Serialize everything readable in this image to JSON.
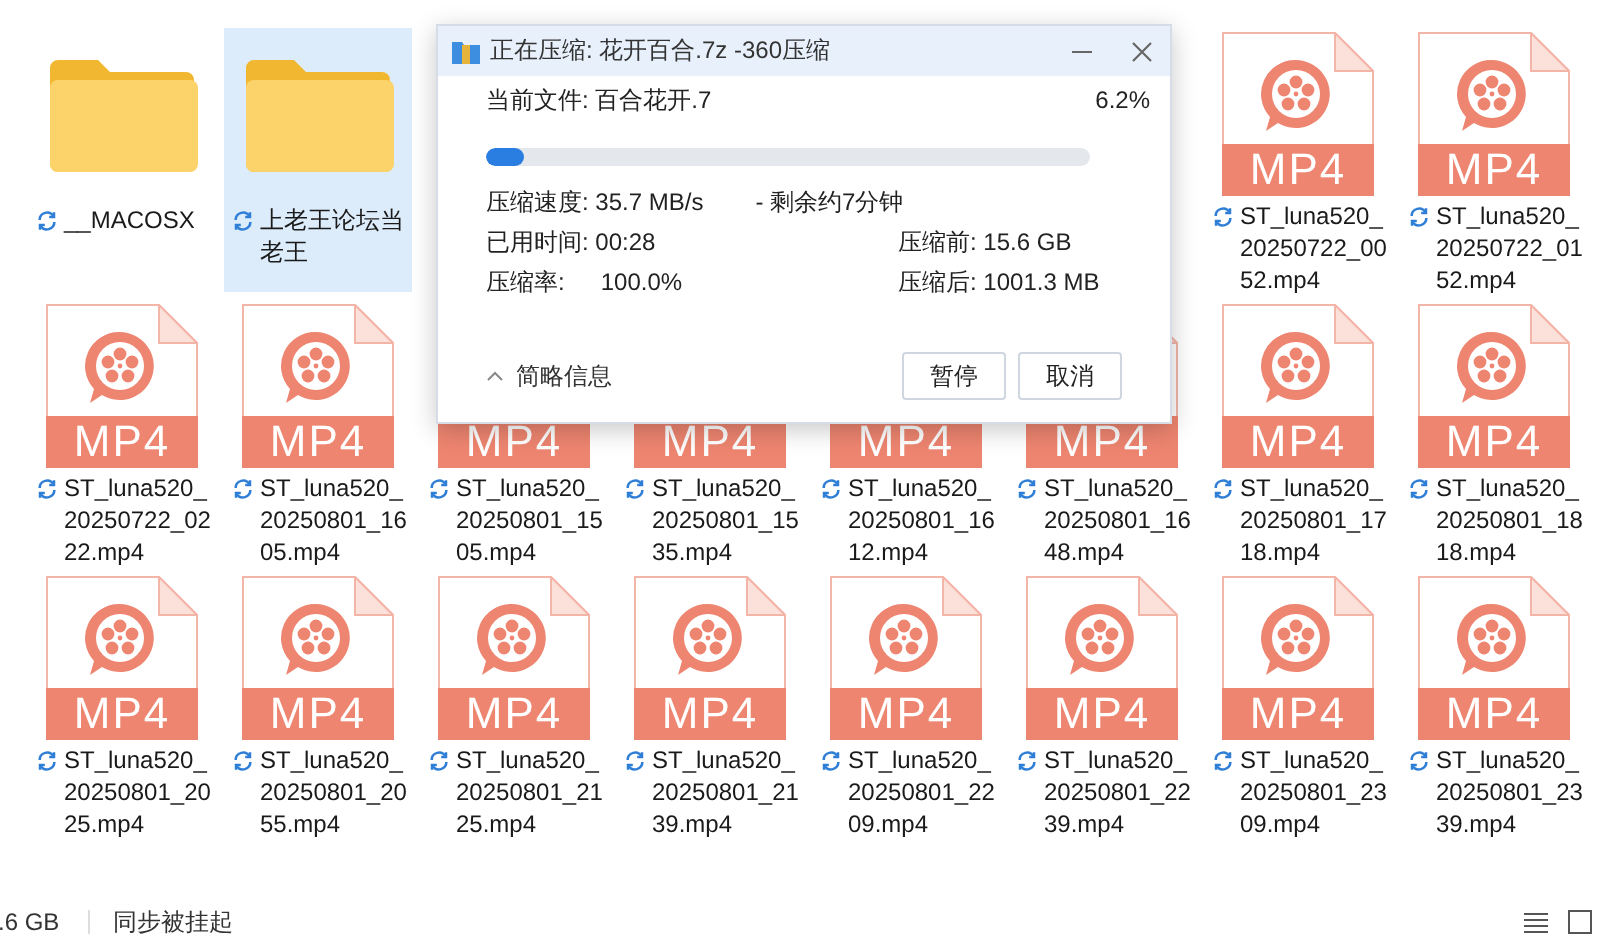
{
  "rows": [
    {
      "items": [
        {
          "kind": "folder",
          "name": "__MACOSX",
          "selected": false
        },
        {
          "kind": "folder",
          "name": "上老王论坛当老王",
          "selected": true
        },
        {
          "kind": "mp4",
          "name": "ST_luna520_20250722_0052.mp4",
          "badge": "MP4",
          "selected": false
        },
        {
          "kind": "mp4",
          "name": "ST_luna520_20250722_0152.mp4",
          "badge": "MP4",
          "selected": false
        }
      ]
    },
    {
      "items": [
        {
          "kind": "mp4",
          "name": "ST_luna520_20250722_0222.mp4",
          "badge": "MP4",
          "selected": false
        },
        {
          "kind": "mp4",
          "name": "ST_luna520_20250801_1605.mp4",
          "badge": "MP4",
          "selected": false
        },
        {
          "kind": "mp4",
          "name": "ST_luna520_20250801_1505.mp4",
          "badge": "MP4",
          "selected": false
        },
        {
          "kind": "mp4",
          "name": "ST_luna520_20250801_1535.mp4",
          "badge": "MP4",
          "selected": false
        },
        {
          "kind": "mp4",
          "name": "ST_luna520_20250801_1612.mp4",
          "badge": "MP4",
          "selected": false
        },
        {
          "kind": "mp4",
          "name": "ST_luna520_20250801_1648.mp4",
          "badge": "MP4",
          "selected": false
        },
        {
          "kind": "mp4",
          "name": "ST_luna520_20250801_1718.mp4",
          "badge": "MP4",
          "selected": false
        },
        {
          "kind": "mp4",
          "name": "ST_luna520_20250801_1818.mp4",
          "badge": "MP4",
          "selected": false
        }
      ]
    },
    {
      "items": [
        {
          "kind": "mp4",
          "name": "ST_luna520_20250801_2025.mp4",
          "badge": "MP4",
          "selected": false
        },
        {
          "kind": "mp4",
          "name": "ST_luna520_20250801_2055.mp4",
          "badge": "MP4",
          "selected": false
        },
        {
          "kind": "mp4",
          "name": "ST_luna520_20250801_2125.mp4",
          "badge": "MP4",
          "selected": false
        },
        {
          "kind": "mp4",
          "name": "ST_luna520_20250801_2139.mp4",
          "badge": "MP4",
          "selected": false
        },
        {
          "kind": "mp4",
          "name": "ST_luna520_20250801_2209.mp4",
          "badge": "MP4",
          "selected": false
        },
        {
          "kind": "mp4",
          "name": "ST_luna520_20250801_2239.mp4",
          "badge": "MP4",
          "selected": false
        },
        {
          "kind": "mp4",
          "name": "ST_luna520_20250801_2309.mp4",
          "badge": "MP4",
          "selected": false
        },
        {
          "kind": "mp4",
          "name": "ST_luna520_20250801_2339.mp4",
          "badge": "MP4",
          "selected": false
        }
      ]
    }
  ],
  "dialog": {
    "title": "正在压缩: 花开百合.7z -360压缩",
    "current_file": "当前文件: 百合花开.7",
    "percent": "6.2%",
    "level": 0.062,
    "speed": "压缩速度: 35.7 MB/s",
    "remaining": "- 剩余约7分钟",
    "elapsed": "已用时间: 00:28",
    "before": "压缩前: 15.6 GB",
    "ratio_label": "压缩率:",
    "ratio": "100.0%",
    "after": "压缩后: 1001.3 MB",
    "details_toggle": "简略信息",
    "buttons": [
      "暂停",
      "取消"
    ]
  },
  "status_bar": {
    "size": ".6 GB",
    "sync_status": "同步被挂起"
  }
}
